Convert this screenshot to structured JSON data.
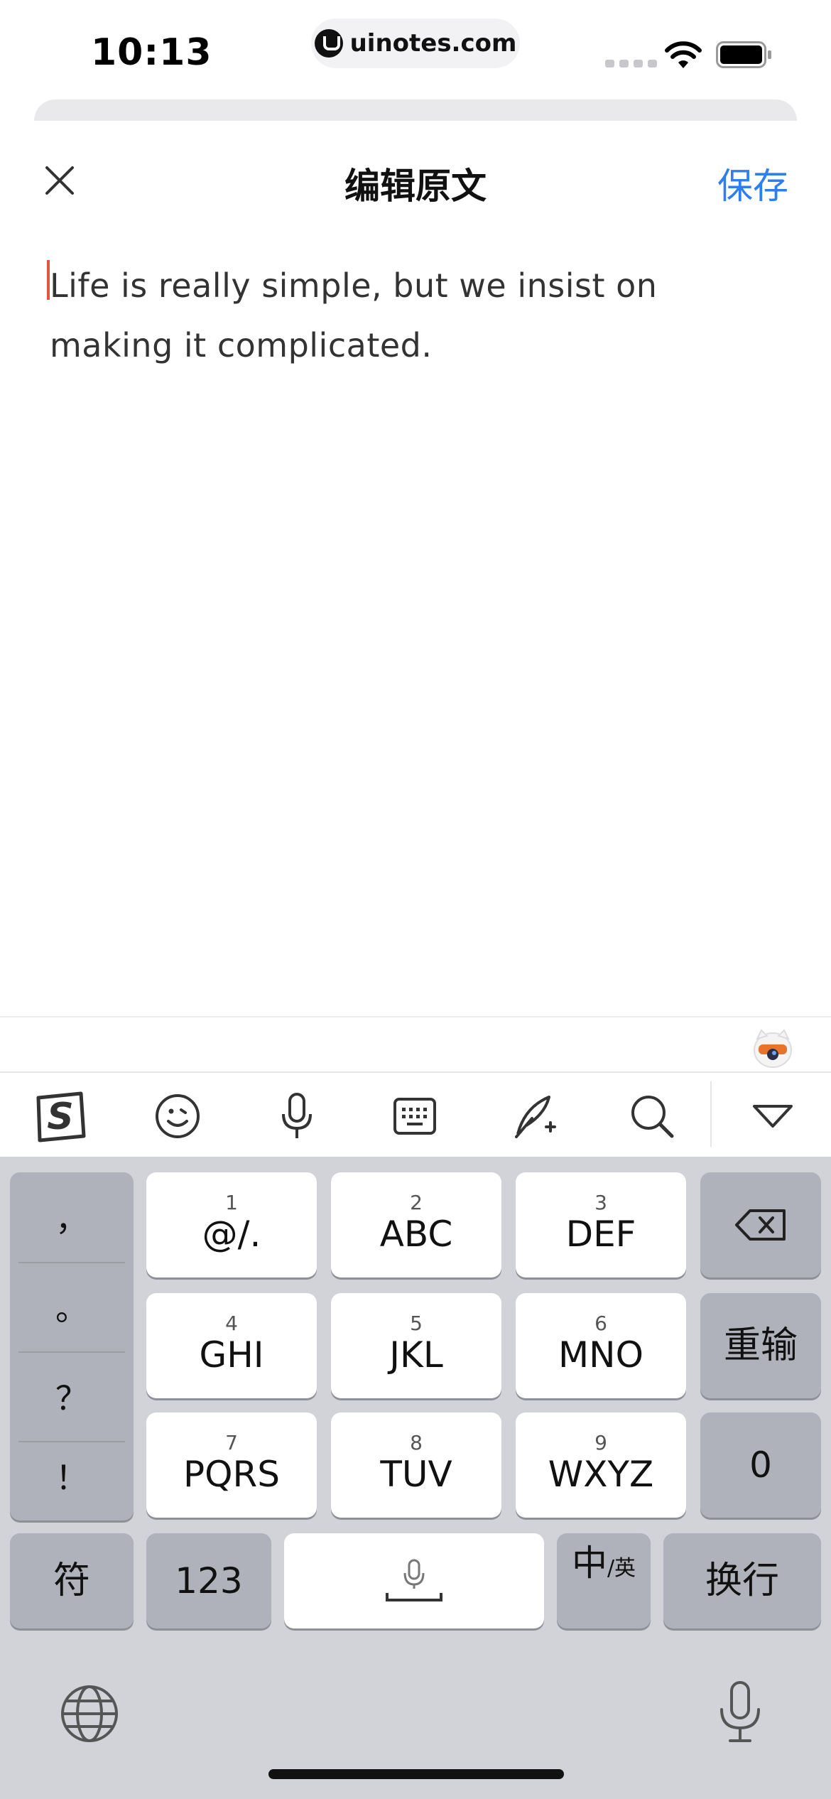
{
  "status_bar": {
    "time": "10:13",
    "url": "uinotes.com"
  },
  "nav": {
    "title": "编辑原文",
    "save_label": "保存"
  },
  "editor": {
    "text": "Life is really simple, but we insist on making it complicated."
  },
  "toolbar": {
    "icons": [
      "sogou-logo-icon",
      "emoji-icon",
      "microphone-icon",
      "keyboard-icon",
      "handwriting-icon",
      "search-icon",
      "collapse-icon"
    ]
  },
  "keyboard": {
    "punctuation": [
      "，",
      "。",
      "？",
      "！"
    ],
    "keys": [
      {
        "num": "1",
        "label": "@/."
      },
      {
        "num": "2",
        "label": "ABC"
      },
      {
        "num": "3",
        "label": "DEF"
      },
      {
        "num": "4",
        "label": "GHI"
      },
      {
        "num": "5",
        "label": "JKL"
      },
      {
        "num": "6",
        "label": "MNO"
      },
      {
        "num": "7",
        "label": "PQRS"
      },
      {
        "num": "8",
        "label": "TUV"
      },
      {
        "num": "9",
        "label": "WXYZ"
      }
    ],
    "reenter_label": "重输",
    "zero_label": "0",
    "symbol_label": "符",
    "numbers_label": "123",
    "lang_main": "中",
    "lang_sub": "/英",
    "return_label": "换行"
  },
  "colors": {
    "accent": "#2d7ff0",
    "caret": "#e2553f",
    "keyboard_bg": "#d1d3d9"
  }
}
